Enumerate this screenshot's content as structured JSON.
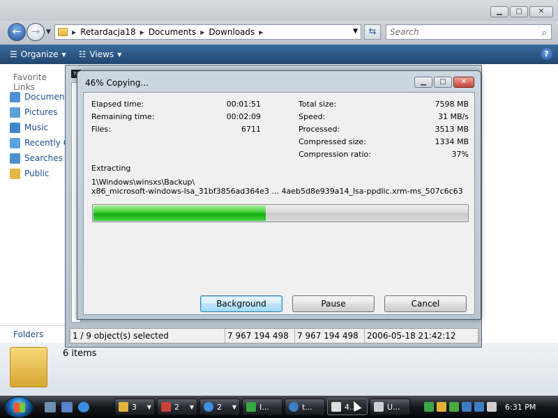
{
  "explorer": {
    "breadcrumb": [
      "Retardacja18",
      "Documents",
      "Downloads"
    ],
    "search_placeholder": "Search",
    "commands": [
      {
        "label": "Organize",
        "icon": "organize-icon"
      },
      {
        "label": "Views",
        "icon": "views-icon"
      }
    ],
    "favorite_links_title": "Favorite Links",
    "favorites": [
      {
        "label": "Documents",
        "icon": "documents-icon",
        "color": "#4f8fd6"
      },
      {
        "label": "Pictures",
        "icon": "pictures-icon",
        "color": "#5fa0d8"
      },
      {
        "label": "Music",
        "icon": "music-icon",
        "color": "#3f86c9"
      },
      {
        "label": "Recently Changed",
        "icon": "recently-changed-icon",
        "color": "#5aa3df"
      },
      {
        "label": "Searches",
        "icon": "searches-icon",
        "color": "#4b8fce"
      },
      {
        "label": "Public",
        "icon": "public-folder-icon",
        "color": "#e4b743"
      }
    ],
    "folders_label": "Folders",
    "items_count": "6 items"
  },
  "archive_window": {
    "icon_text": "7z",
    "status": [
      "1 / 9 object(s) selected",
      "7 967 194 498",
      "7 967 194 498",
      "2006-05-18 21:42:12"
    ]
  },
  "dialog": {
    "title": "46% Copying...",
    "left_stats": [
      {
        "label": "Elapsed time:",
        "value": "00:01:51"
      },
      {
        "label": "Remaining time:",
        "value": "00:02:09"
      },
      {
        "label": "Files:",
        "value": "6711"
      }
    ],
    "right_stats": [
      {
        "label": "Total size:",
        "value": "7598 MB"
      },
      {
        "label": "Speed:",
        "value": "31 MB/s"
      },
      {
        "label": "Processed:",
        "value": "3513 MB"
      },
      {
        "label": "Compressed size:",
        "value": "1334 MB"
      },
      {
        "label": "Compression ratio:",
        "value": "37%"
      }
    ],
    "operation": "Extracting",
    "path_line1": "1\\Windows\\winsxs\\Backup\\",
    "path_line2": "x86_microsoft-windows-lsa_31bf3856ad364e3 ... 4aeb5d8e939a14_lsa-ppdlic.xrm-ms_507c6c63",
    "progress": 0.46,
    "buttons": {
      "background": "Background",
      "pause": "Pause",
      "cancel": "Cancel"
    }
  },
  "taskbar": {
    "quick_launch": [
      {
        "icon": "show-desktop-icon",
        "color": "#6f8fb0"
      },
      {
        "icon": "switch-windows-icon",
        "color": "#5a83c7"
      },
      {
        "icon": "internet-explorer-icon",
        "color": "#3c8fe0"
      }
    ],
    "buttons": [
      {
        "label": "3",
        "icon": "folder-group-icon",
        "color": "#e3b13f",
        "arrow": true
      },
      {
        "label": "2",
        "icon": "archive-group-icon",
        "color": "#c9423a",
        "arrow": true
      },
      {
        "label": "2",
        "icon": "ie-group-icon",
        "color": "#3c8fe0",
        "arrow": true
      },
      {
        "label": "I...",
        "icon": "app-icon",
        "color": "#3aa845",
        "arrow": false
      },
      {
        "label": "t...",
        "icon": "app-icon",
        "color": "#3f7fc4",
        "arrow": false
      },
      {
        "label": "4...",
        "icon": "7zip-icon",
        "color": "#dddddd",
        "arrow": false
      },
      {
        "label": "U...",
        "icon": "document-icon",
        "color": "#c9cfd6",
        "arrow": false
      }
    ],
    "tray_icons": [
      {
        "icon": "flag-icon",
        "color": "#3aa845"
      },
      {
        "icon": "shield-icon",
        "color": "#e0b234"
      },
      {
        "icon": "security-icon",
        "color": "#4aa843"
      },
      {
        "icon": "network-icon",
        "color": "#3c7fc4"
      },
      {
        "icon": "monitor-icon",
        "color": "#3c7fc4"
      },
      {
        "icon": "volume-muted-icon",
        "color": "#cfcfcf"
      }
    ],
    "clock": "6:31 PM"
  }
}
